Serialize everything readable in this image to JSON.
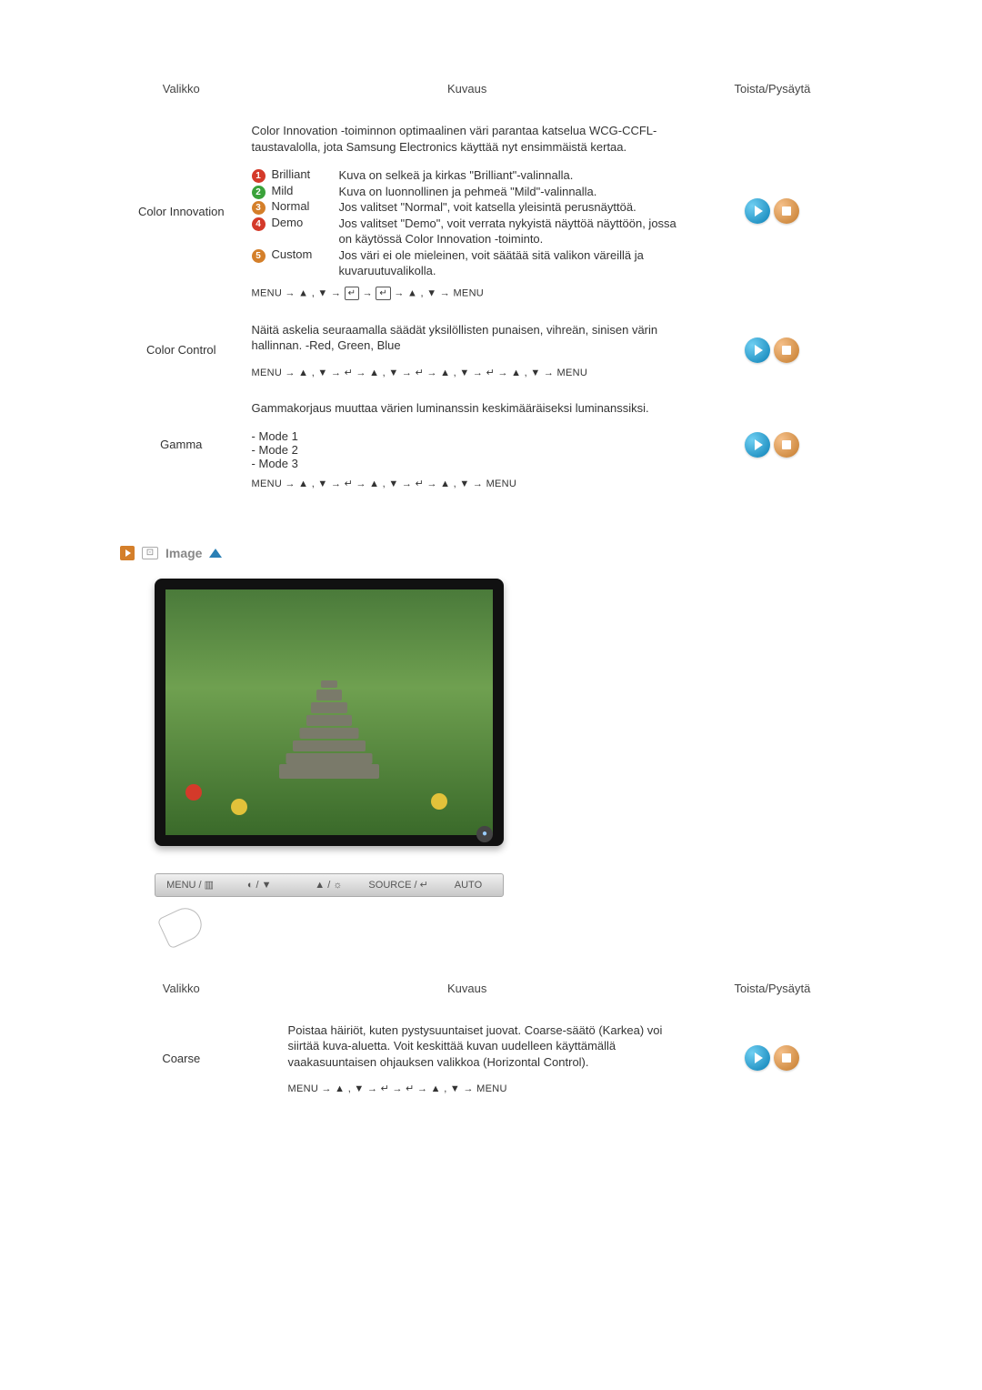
{
  "table1": {
    "headers": {
      "menu": "Valikko",
      "desc": "Kuvaus",
      "play": "Toista/Pysäytä"
    },
    "rows": {
      "colorInnovation": {
        "label": "Color Innovation",
        "intro": "Color Innovation -toiminnon optimaalinen väri parantaa katselua WCG-CCFL-taustavalolla, jota Samsung Electronics käyttää nyt ensimmäistä kertaa.",
        "opts": [
          {
            "num": "1",
            "name": "Brilliant",
            "text": "Kuva on selkeä ja kirkas \"Brilliant\"-valinnalla."
          },
          {
            "num": "2",
            "name": "Mild",
            "text": "Kuva on luonnollinen ja pehmeä \"Mild\"-valinnalla."
          },
          {
            "num": "3",
            "name": "Normal",
            "text": "Jos valitset \"Normal\", voit katsella yleisintä perusnäyttöä."
          },
          {
            "num": "4",
            "name": "Demo",
            "text": "Jos valitset \"Demo\", voit verrata nykyistä näyttöä näyttöön, jossa on käytössä Color Innovation -toiminto."
          },
          {
            "num": "5",
            "name": "Custom",
            "text": "Jos väri ei ole mieleinen, voit säätää sitä valikon väreillä ja kuvaruutuvalikolla."
          }
        ],
        "seq_pre": "MENU → ▲ , ▼ → ",
        "seq_mid": " → ",
        "seq_post": " → ▲ , ▼ → MENU"
      },
      "colorControl": {
        "label": "Color Control",
        "intro": "Näitä askelia seuraamalla säädät yksilöllisten punaisen, vihreän, sinisen värin hallinnan. -Red, Green, Blue",
        "seq": "MENU → ▲ , ▼ → ↵ → ▲ , ▼ → ↵ → ▲ , ▼ → ↵ → ▲ , ▼ → MENU"
      },
      "gamma": {
        "label": "Gamma",
        "intro": "Gammakorjaus muuttaa värien luminanssin keskimääräiseksi luminanssiksi.",
        "modes": [
          "- Mode 1",
          "- Mode 2",
          "- Mode 3"
        ],
        "seq": "MENU → ▲ , ▼ → ↵ → ▲ , ▼ → ↵ → ▲ , ▼ → MENU"
      }
    }
  },
  "section_image": {
    "title": "Image"
  },
  "button_bar": {
    "b1": "MENU / ▥",
    "b2": "◐ / ▼",
    "b3": "▲ / ☼",
    "b4": "SOURCE / ↵",
    "b5": "AUTO"
  },
  "table2": {
    "headers": {
      "menu": "Valikko",
      "desc": "Kuvaus",
      "play": "Toista/Pysäytä"
    },
    "rows": {
      "coarse": {
        "label": "Coarse",
        "desc": "Poistaa häiriöt, kuten pystysuuntaiset juovat. Coarse-säätö (Karkea) voi siirtää kuva-aluetta. Voit keskittää kuvan uudelleen käyttämällä vaakasuuntaisen ohjauksen valikkoa (Horizontal Control).",
        "seq": "MENU → ▲ , ▼ → ↵ → ↵ → ▲ , ▼ → MENU"
      }
    }
  },
  "icons": {
    "enter": "↵"
  }
}
